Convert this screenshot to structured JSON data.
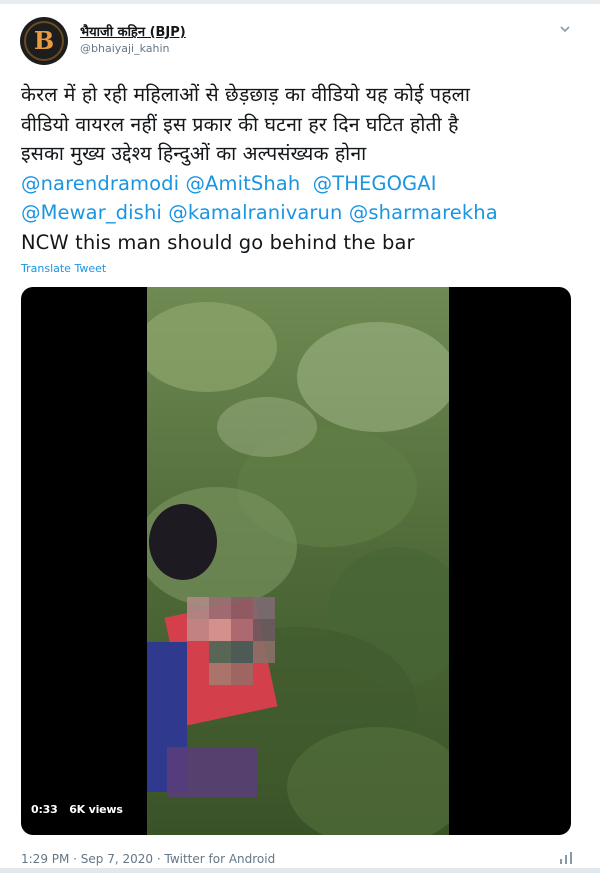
{
  "author": {
    "display_name": "भैयाजी कहिन (BJP)",
    "handle": "@bhaiyaji_kahin",
    "avatar_icon": "avatar-logo-icon",
    "avatar_letter": "B"
  },
  "menu": {
    "icon": "chevron-down-icon"
  },
  "tweet": {
    "lines": [
      "केरल में हो रही महिलाओं से छेड़छाड़ का वीडियो यह कोई पहला",
      "वीडियो वायरल नहीं इस प्रकार की घटना हर दिन घटित होती है",
      "इसका मुख्य उद्देश्य हिन्दुओं का अल्पसंख्यक होना"
    ],
    "mentions_row1": [
      "@narendramodi",
      "@AmitShah",
      "@THEGOGAI"
    ],
    "mentions_row2": [
      "@Mewar_dishi",
      "@kamalranivarun",
      "@sharmarekha"
    ],
    "closing_line": "NCW this man should go behind the bar",
    "translate_label": "Translate Tweet"
  },
  "video": {
    "duration": "0:33",
    "views": "6K views"
  },
  "footer": {
    "meta": "1:29 PM · Sep 7, 2020 · Twitter for Android",
    "icon": "analytics-icon"
  },
  "colors": {
    "link": "#1b95e0",
    "text": "#14171a",
    "muted": "#657786"
  }
}
